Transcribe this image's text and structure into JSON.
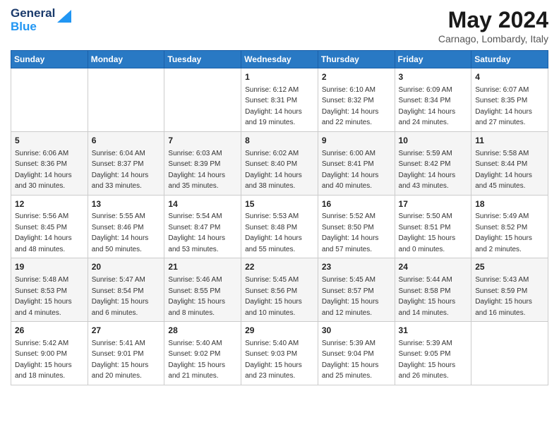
{
  "header": {
    "logo_general": "General",
    "logo_blue": "Blue",
    "month_year": "May 2024",
    "location": "Carnago, Lombardy, Italy"
  },
  "days_of_week": [
    "Sunday",
    "Monday",
    "Tuesday",
    "Wednesday",
    "Thursday",
    "Friday",
    "Saturday"
  ],
  "weeks": [
    [
      {
        "day": "",
        "info": ""
      },
      {
        "day": "",
        "info": ""
      },
      {
        "day": "",
        "info": ""
      },
      {
        "day": "1",
        "info": "Sunrise: 6:12 AM\nSunset: 8:31 PM\nDaylight: 14 hours\nand 19 minutes."
      },
      {
        "day": "2",
        "info": "Sunrise: 6:10 AM\nSunset: 8:32 PM\nDaylight: 14 hours\nand 22 minutes."
      },
      {
        "day": "3",
        "info": "Sunrise: 6:09 AM\nSunset: 8:34 PM\nDaylight: 14 hours\nand 24 minutes."
      },
      {
        "day": "4",
        "info": "Sunrise: 6:07 AM\nSunset: 8:35 PM\nDaylight: 14 hours\nand 27 minutes."
      }
    ],
    [
      {
        "day": "5",
        "info": "Sunrise: 6:06 AM\nSunset: 8:36 PM\nDaylight: 14 hours\nand 30 minutes."
      },
      {
        "day": "6",
        "info": "Sunrise: 6:04 AM\nSunset: 8:37 PM\nDaylight: 14 hours\nand 33 minutes."
      },
      {
        "day": "7",
        "info": "Sunrise: 6:03 AM\nSunset: 8:39 PM\nDaylight: 14 hours\nand 35 minutes."
      },
      {
        "day": "8",
        "info": "Sunrise: 6:02 AM\nSunset: 8:40 PM\nDaylight: 14 hours\nand 38 minutes."
      },
      {
        "day": "9",
        "info": "Sunrise: 6:00 AM\nSunset: 8:41 PM\nDaylight: 14 hours\nand 40 minutes."
      },
      {
        "day": "10",
        "info": "Sunrise: 5:59 AM\nSunset: 8:42 PM\nDaylight: 14 hours\nand 43 minutes."
      },
      {
        "day": "11",
        "info": "Sunrise: 5:58 AM\nSunset: 8:44 PM\nDaylight: 14 hours\nand 45 minutes."
      }
    ],
    [
      {
        "day": "12",
        "info": "Sunrise: 5:56 AM\nSunset: 8:45 PM\nDaylight: 14 hours\nand 48 minutes."
      },
      {
        "day": "13",
        "info": "Sunrise: 5:55 AM\nSunset: 8:46 PM\nDaylight: 14 hours\nand 50 minutes."
      },
      {
        "day": "14",
        "info": "Sunrise: 5:54 AM\nSunset: 8:47 PM\nDaylight: 14 hours\nand 53 minutes."
      },
      {
        "day": "15",
        "info": "Sunrise: 5:53 AM\nSunset: 8:48 PM\nDaylight: 14 hours\nand 55 minutes."
      },
      {
        "day": "16",
        "info": "Sunrise: 5:52 AM\nSunset: 8:50 PM\nDaylight: 14 hours\nand 57 minutes."
      },
      {
        "day": "17",
        "info": "Sunrise: 5:50 AM\nSunset: 8:51 PM\nDaylight: 15 hours\nand 0 minutes."
      },
      {
        "day": "18",
        "info": "Sunrise: 5:49 AM\nSunset: 8:52 PM\nDaylight: 15 hours\nand 2 minutes."
      }
    ],
    [
      {
        "day": "19",
        "info": "Sunrise: 5:48 AM\nSunset: 8:53 PM\nDaylight: 15 hours\nand 4 minutes."
      },
      {
        "day": "20",
        "info": "Sunrise: 5:47 AM\nSunset: 8:54 PM\nDaylight: 15 hours\nand 6 minutes."
      },
      {
        "day": "21",
        "info": "Sunrise: 5:46 AM\nSunset: 8:55 PM\nDaylight: 15 hours\nand 8 minutes."
      },
      {
        "day": "22",
        "info": "Sunrise: 5:45 AM\nSunset: 8:56 PM\nDaylight: 15 hours\nand 10 minutes."
      },
      {
        "day": "23",
        "info": "Sunrise: 5:45 AM\nSunset: 8:57 PM\nDaylight: 15 hours\nand 12 minutes."
      },
      {
        "day": "24",
        "info": "Sunrise: 5:44 AM\nSunset: 8:58 PM\nDaylight: 15 hours\nand 14 minutes."
      },
      {
        "day": "25",
        "info": "Sunrise: 5:43 AM\nSunset: 8:59 PM\nDaylight: 15 hours\nand 16 minutes."
      }
    ],
    [
      {
        "day": "26",
        "info": "Sunrise: 5:42 AM\nSunset: 9:00 PM\nDaylight: 15 hours\nand 18 minutes."
      },
      {
        "day": "27",
        "info": "Sunrise: 5:41 AM\nSunset: 9:01 PM\nDaylight: 15 hours\nand 20 minutes."
      },
      {
        "day": "28",
        "info": "Sunrise: 5:40 AM\nSunset: 9:02 PM\nDaylight: 15 hours\nand 21 minutes."
      },
      {
        "day": "29",
        "info": "Sunrise: 5:40 AM\nSunset: 9:03 PM\nDaylight: 15 hours\nand 23 minutes."
      },
      {
        "day": "30",
        "info": "Sunrise: 5:39 AM\nSunset: 9:04 PM\nDaylight: 15 hours\nand 25 minutes."
      },
      {
        "day": "31",
        "info": "Sunrise: 5:39 AM\nSunset: 9:05 PM\nDaylight: 15 hours\nand 26 minutes."
      },
      {
        "day": "",
        "info": ""
      }
    ]
  ]
}
